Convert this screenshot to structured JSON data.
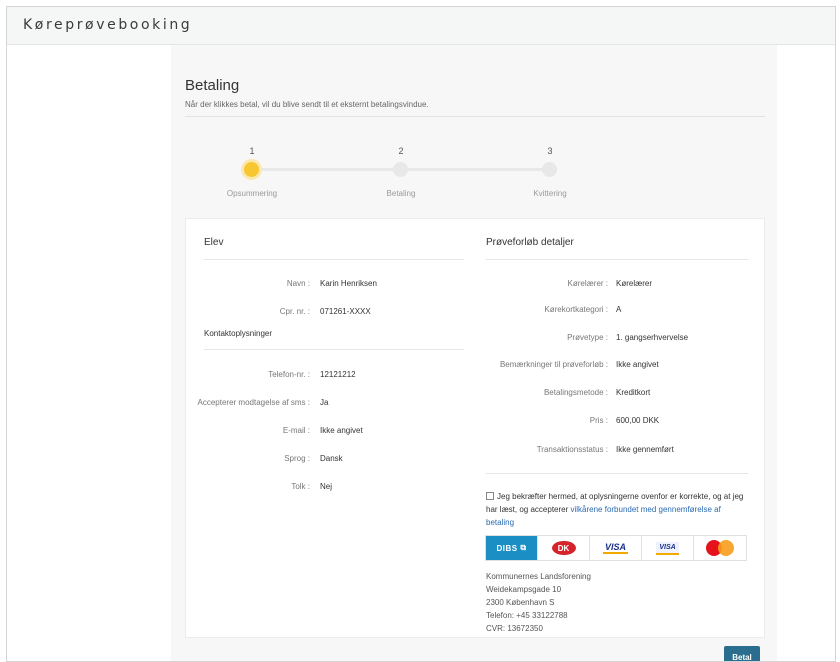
{
  "app": {
    "title": "Køreprøvebooking"
  },
  "header": {
    "title": "Betaling",
    "subtitle": "Når der klikkes betal, vil du blive sendt til et eksternt betalingsvindue."
  },
  "steps": [
    {
      "number": "1",
      "label": "Opsummering",
      "active": true
    },
    {
      "number": "2",
      "label": "Betaling",
      "active": false
    },
    {
      "number": "3",
      "label": "Kvittering",
      "active": false
    }
  ],
  "elev": {
    "title": "Elev",
    "name_label": "Navn :",
    "name_value": "Karin Henriksen",
    "cpr_label": "Cpr. nr. :",
    "cpr_value": "071261-XXXX",
    "contact_heading": "Kontaktoplysninger",
    "phone_label": "Telefon-nr. :",
    "phone_value": "12121212",
    "sms_label": "Accepterer modtagelse af sms :",
    "sms_value": "Ja",
    "email_label": "E-mail :",
    "email_value": "Ikke angivet",
    "language_label": "Sprog :",
    "language_value": "Dansk",
    "interpreter_label": "Tolk :",
    "interpreter_value": "Nej"
  },
  "details": {
    "title": "Prøveforløb detaljer",
    "instructor_label": "Kørelærer :",
    "instructor_value": "Kørelærer",
    "category_label": "Kørekortkategori :",
    "category_value": "A",
    "testtype_label": "Prøvetype :",
    "testtype_value": "1. gangserhvervelse",
    "remarks_label": "Bemærkninger til prøveforløb :",
    "remarks_value": "Ikke angivet",
    "paymethod_label": "Betalingsmetode :",
    "paymethod_value": "Kreditkort",
    "price_label": "Pris :",
    "price_value": "600,00 DKK",
    "status_label": "Transaktionsstatus :",
    "status_value": "Ikke gennemført"
  },
  "consent": {
    "text": "Jeg bekræfter hermed, at oplysningerne ovenfor er korrekte, og at jeg har læst, og accepterer ",
    "link": "vilkårene forbundet med gennemførelse af betaling",
    "checked": false
  },
  "payment_logos": {
    "dibs": "DIBS",
    "dankort": "DK",
    "visa": "VISA",
    "visa_electron": "VISA",
    "mastercard": "mastercard"
  },
  "address": {
    "line1": "Kommunernes Landsforening",
    "line2": "Weidekampsgade 10",
    "line3": "2300 København S",
    "line4": "Telefon: +45 33122788",
    "line5": "CVR: 13672350"
  },
  "actions": {
    "pay_label": "Betal"
  },
  "colors": {
    "accent": "#2a6d8e",
    "step_active": "#f7c631",
    "link": "#2a6ab3",
    "dibs": "#1b8fc4"
  }
}
